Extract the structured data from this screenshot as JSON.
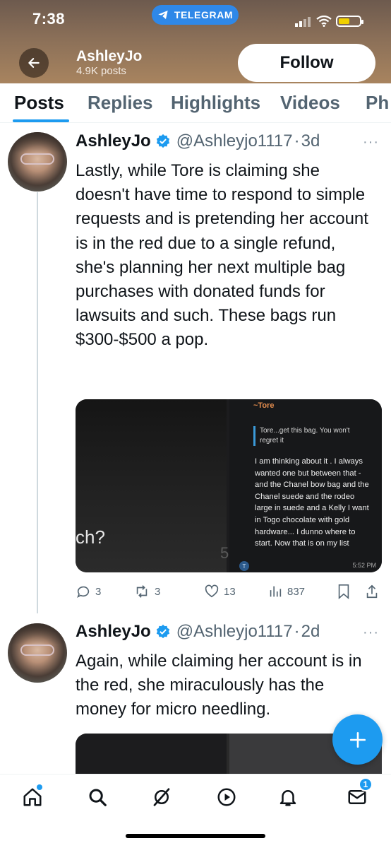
{
  "status_bar": {
    "time": "7:38",
    "pill_label": "TELEGRAM",
    "battery_level": 0.55
  },
  "header": {
    "back_icon": "arrow-left-icon",
    "profile_name": "AshleyJo",
    "post_count": "4.9K posts",
    "follow_label": "Follow"
  },
  "tabs": [
    {
      "label": "Posts",
      "active": true
    },
    {
      "label": "Replies",
      "active": false
    },
    {
      "label": "Highlights",
      "active": false
    },
    {
      "label": "Videos",
      "active": false
    },
    {
      "label": "Ph",
      "active": false
    }
  ],
  "tweets": [
    {
      "name": "AshleyJo",
      "handle": "@Ashleyjo1117",
      "age": "3d",
      "text": "Lastly, while Tore is claiming she doesn't have time to respond to simple requests and is pretending her account is in the red due to a single refund, she's planning her next multiple bag purchases with donated funds for lawsuits and such. These bags run $300-$500 a pop.",
      "media": {
        "left_text": "ch?",
        "left_digit": "5",
        "chat_sender": "~Tore",
        "chat_quote": "Tore...get this bag. You won't regret it",
        "chat_message": "I am thinking about it . I always wanted one but between that - and the Chanel bow bag and the Chanel suede and the rodeo large in suede and a Kelly I want in Togo chocolate with gold hardware... I dunno where to start. Now that is on my list",
        "chat_time": "5:52 PM",
        "chat_avatar_letter": "T"
      },
      "stats": {
        "replies": "3",
        "reposts": "3",
        "likes": "13",
        "views": "837"
      }
    },
    {
      "name": "AshleyJo",
      "handle": "@Ashleyjo1117",
      "age": "2d",
      "text": "Again, while claiming her account is in the red, she miraculously has the money for micro needling."
    }
  ],
  "bottom_nav": {
    "items": [
      "home-icon",
      "search-icon",
      "grok-icon",
      "communities-icon",
      "notifications-icon",
      "messages-icon"
    ],
    "messages_badge": "1"
  },
  "colors": {
    "accent": "#1d9bf0",
    "text_primary": "#0f1419",
    "text_secondary": "#536471"
  }
}
